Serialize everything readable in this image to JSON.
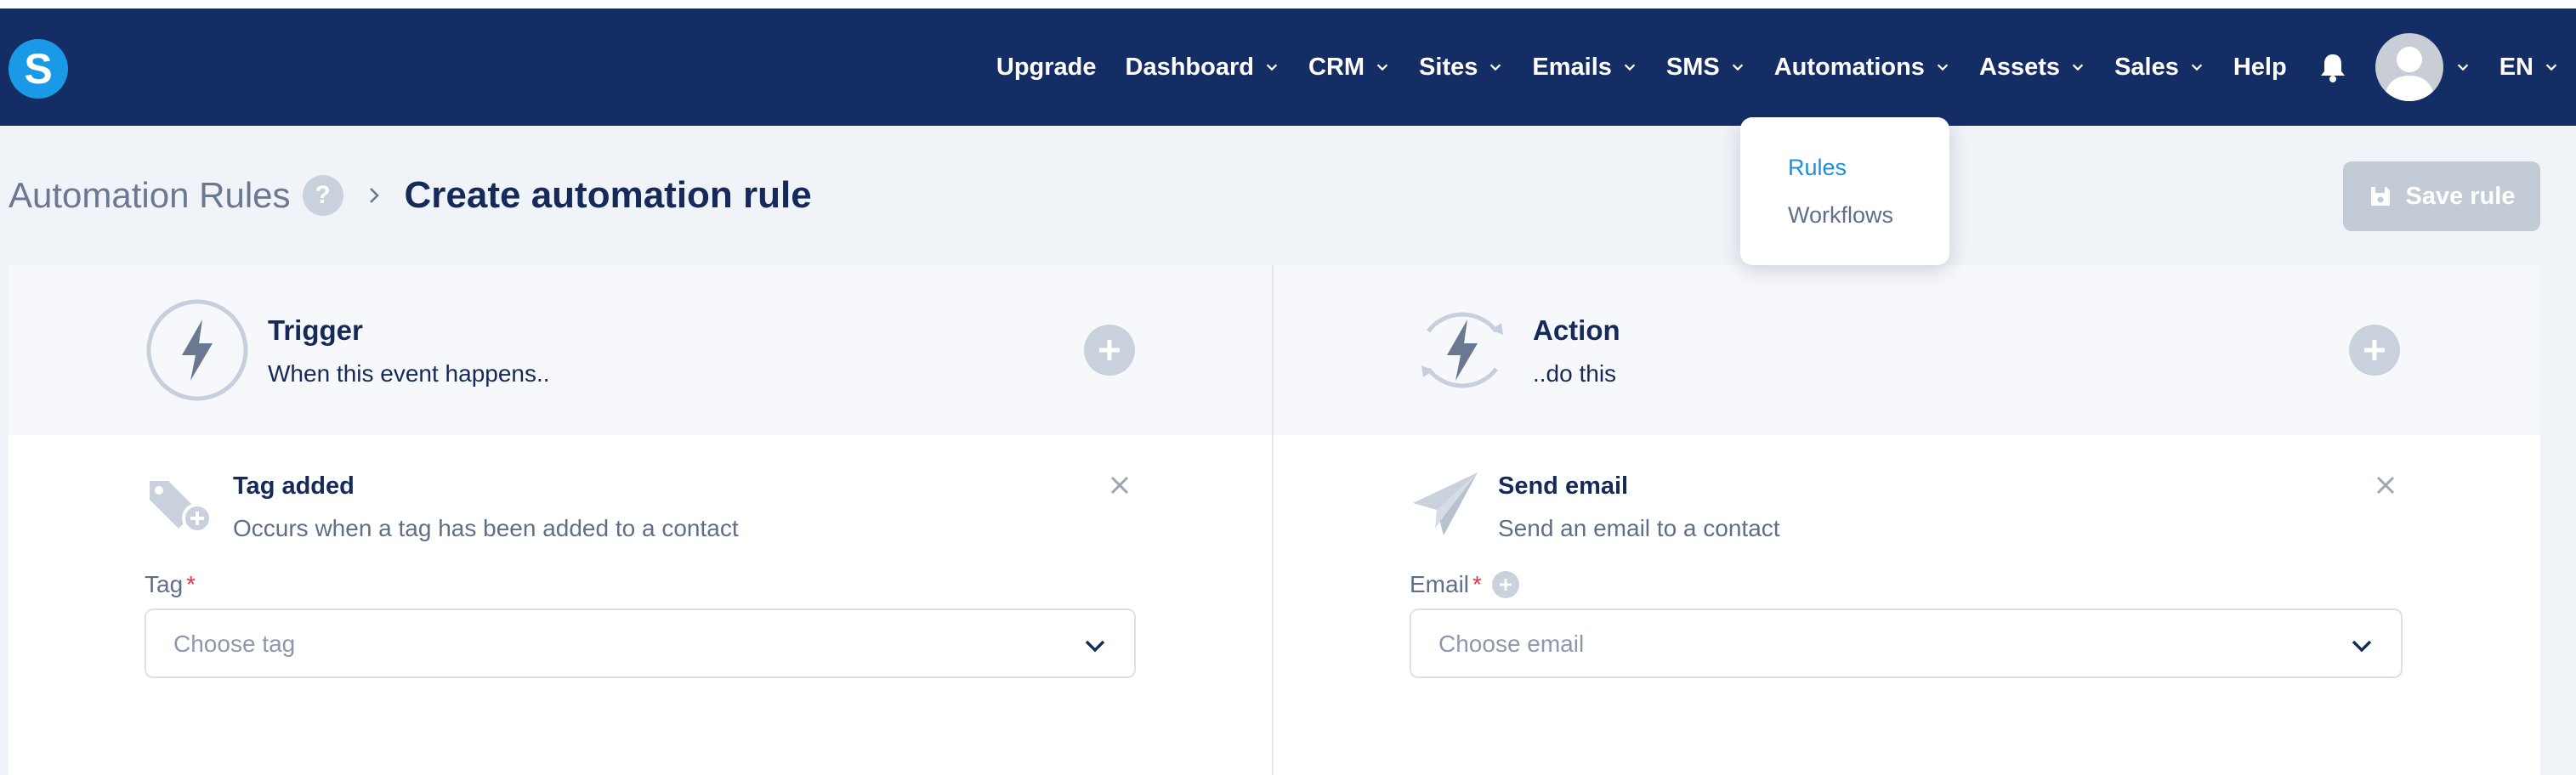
{
  "nav": {
    "logo_letter": "S",
    "items": [
      {
        "label": "Upgrade",
        "has_menu": false
      },
      {
        "label": "Dashboard",
        "has_menu": true
      },
      {
        "label": "CRM",
        "has_menu": true
      },
      {
        "label": "Sites",
        "has_menu": true
      },
      {
        "label": "Emails",
        "has_menu": true
      },
      {
        "label": "SMS",
        "has_menu": true
      },
      {
        "label": "Automations",
        "has_menu": true
      },
      {
        "label": "Assets",
        "has_menu": true
      },
      {
        "label": "Sales",
        "has_menu": true
      },
      {
        "label": "Help",
        "has_menu": false
      }
    ],
    "language": "EN"
  },
  "automations_menu": {
    "items": [
      {
        "label": "Rules",
        "active": true
      },
      {
        "label": "Workflows",
        "active": false
      }
    ]
  },
  "breadcrumb": {
    "parent": "Automation Rules",
    "help_symbol": "?",
    "current": "Create automation rule"
  },
  "toolbar": {
    "save_label": "Save rule"
  },
  "trigger": {
    "title": "Trigger",
    "subtitle": "When this event happens..",
    "item": {
      "title": "Tag added",
      "description": "Occurs when a tag has been added to a contact"
    },
    "field": {
      "label": "Tag",
      "required_mark": "*",
      "placeholder": "Choose tag"
    }
  },
  "action": {
    "title": "Action",
    "subtitle": "..do this",
    "item": {
      "title": "Send email",
      "description": "Send an email to a contact"
    },
    "field": {
      "label": "Email",
      "required_mark": "*",
      "placeholder": "Choose email"
    }
  },
  "colors": {
    "navbar": "#142d64",
    "accent": "#1a9ae6",
    "link_active": "#1a8fe0",
    "disabled_button": "#c2cbd6",
    "required": "#e0344a"
  },
  "icons": [
    "bell-icon",
    "avatar-icon",
    "chevron-down-icon",
    "save-icon",
    "bolt-icon",
    "tag-plus-icon",
    "paper-plane-icon",
    "close-icon",
    "plus-circle-icon"
  ]
}
